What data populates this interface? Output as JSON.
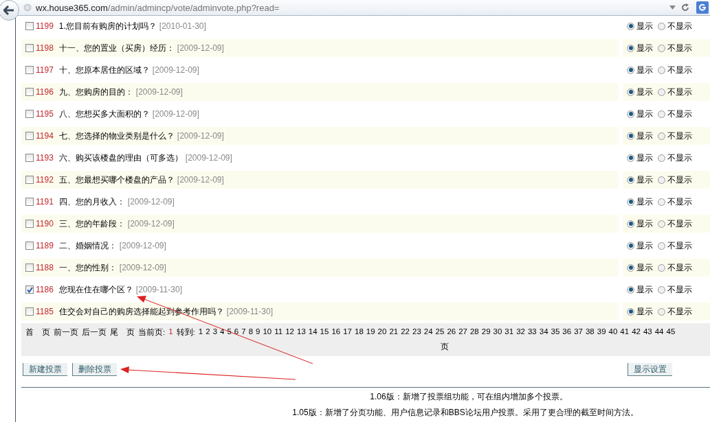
{
  "browser": {
    "url": "**wx.house365.com**/admin/admincp/vote/adminvote.php?read="
  },
  "votes": [
    {
      "id": "1199",
      "title": "1.您目前有购房的计划吗？",
      "date": "[2010-01-30]",
      "checked": false,
      "options": [
        {
          "label": "显示",
          "selected": true
        },
        {
          "label": "不显示",
          "selected": false
        }
      ]
    },
    {
      "id": "1198",
      "title": "十一、您的置业（买房）经历：",
      "date": "[2009-12-09]",
      "checked": false,
      "options": [
        {
          "label": "显示",
          "selected": true
        },
        {
          "label": "不显示",
          "selected": false
        }
      ]
    },
    {
      "id": "1197",
      "title": "十、您原本居住的区域？",
      "date": "[2009-12-09]",
      "checked": false,
      "options": [
        {
          "label": "显示",
          "selected": true
        },
        {
          "label": "不显示",
          "selected": false
        }
      ]
    },
    {
      "id": "1196",
      "title": "九、您购房的目的：",
      "date": "[2009-12-09]",
      "checked": false,
      "options": [
        {
          "label": "显示",
          "selected": true
        },
        {
          "label": "不显示",
          "selected": false
        }
      ]
    },
    {
      "id": "1195",
      "title": "八、您想买多大面积的？",
      "date": "[2009-12-09]",
      "checked": false,
      "options": [
        {
          "label": "显示",
          "selected": true
        },
        {
          "label": "不显示",
          "selected": false
        }
      ]
    },
    {
      "id": "1194",
      "title": "七、您选择的物业类别是什么？",
      "date": "[2009-12-09]",
      "checked": false,
      "options": [
        {
          "label": "显示",
          "selected": true
        },
        {
          "label": "不显示",
          "selected": false
        }
      ]
    },
    {
      "id": "1193",
      "title": "六、购买该楼盘的理由（可多选）",
      "date": "[2009-12-09]",
      "checked": false,
      "options": [
        {
          "label": "显示",
          "selected": true
        },
        {
          "label": "不显示",
          "selected": false
        }
      ]
    },
    {
      "id": "1192",
      "title": "五、您最想买哪个楼盘的产品？",
      "date": "[2009-12-09]",
      "checked": false,
      "options": [
        {
          "label": "显示",
          "selected": true
        },
        {
          "label": "不显示",
          "selected": false
        }
      ]
    },
    {
      "id": "1191",
      "title": "四、您的月收入：",
      "date": "[2009-12-09]",
      "checked": false,
      "options": [
        {
          "label": "显示",
          "selected": true
        },
        {
          "label": "不显示",
          "selected": false
        }
      ]
    },
    {
      "id": "1190",
      "title": "三、您的年龄段：",
      "date": "[2009-12-09]",
      "checked": false,
      "options": [
        {
          "label": "显示",
          "selected": true
        },
        {
          "label": "不显示",
          "selected": false
        }
      ]
    },
    {
      "id": "1189",
      "title": "二、婚姻情况：",
      "date": "[2009-12-09]",
      "checked": false,
      "options": [
        {
          "label": "显示",
          "selected": true
        },
        {
          "label": "不显示",
          "selected": false
        }
      ]
    },
    {
      "id": "1188",
      "title": "一、您的性别：",
      "date": "[2009-12-09]",
      "checked": false,
      "options": [
        {
          "label": "显示",
          "selected": true
        },
        {
          "label": "不显示",
          "selected": false
        }
      ]
    },
    {
      "id": "1186",
      "title": "您现在住在哪个区？",
      "date": "[2009-11-30]",
      "checked": true,
      "options": [
        {
          "label": "显示",
          "selected": true
        },
        {
          "label": "不显示",
          "selected": false
        }
      ]
    },
    {
      "id": "1185",
      "title": "住交会对自己的购房选择能起到参考作用吗？",
      "date": "[2009-11-30]",
      "checked": false,
      "options": [
        {
          "label": "显示",
          "selected": true
        },
        {
          "label": "不显示",
          "selected": false
        }
      ]
    }
  ],
  "pager": {
    "links": [
      "首　页",
      "前一页",
      "后一页",
      "尾　页"
    ],
    "current_label": "当前页:",
    "current": "1",
    "goto_label": "转到:",
    "pages": [
      "1",
      "2",
      "3",
      "4",
      "5",
      "6",
      "7",
      "8",
      "9",
      "10",
      "11",
      "12",
      "13",
      "14",
      "15",
      "16",
      "17",
      "18",
      "19",
      "20",
      "21",
      "22",
      "23",
      "24",
      "25",
      "26",
      "27",
      "28",
      "29",
      "30",
      "31",
      "32",
      "33",
      "34",
      "35",
      "36",
      "37",
      "38",
      "39",
      "40",
      "41",
      "42",
      "43",
      "44",
      "45"
    ],
    "tail": "页"
  },
  "buttons": [
    {
      "label": "新建投票"
    },
    {
      "label": "删除投票"
    }
  ],
  "settings_button": {
    "label": "显示设置"
  },
  "changelog": [
    "1.06版：新增了投票组功能，可在组内增加多个投票。",
    "1.05版：新增了分页功能、用户信息记录和BBS论坛用户投票。采用了更合理的截至时间方法。"
  ]
}
